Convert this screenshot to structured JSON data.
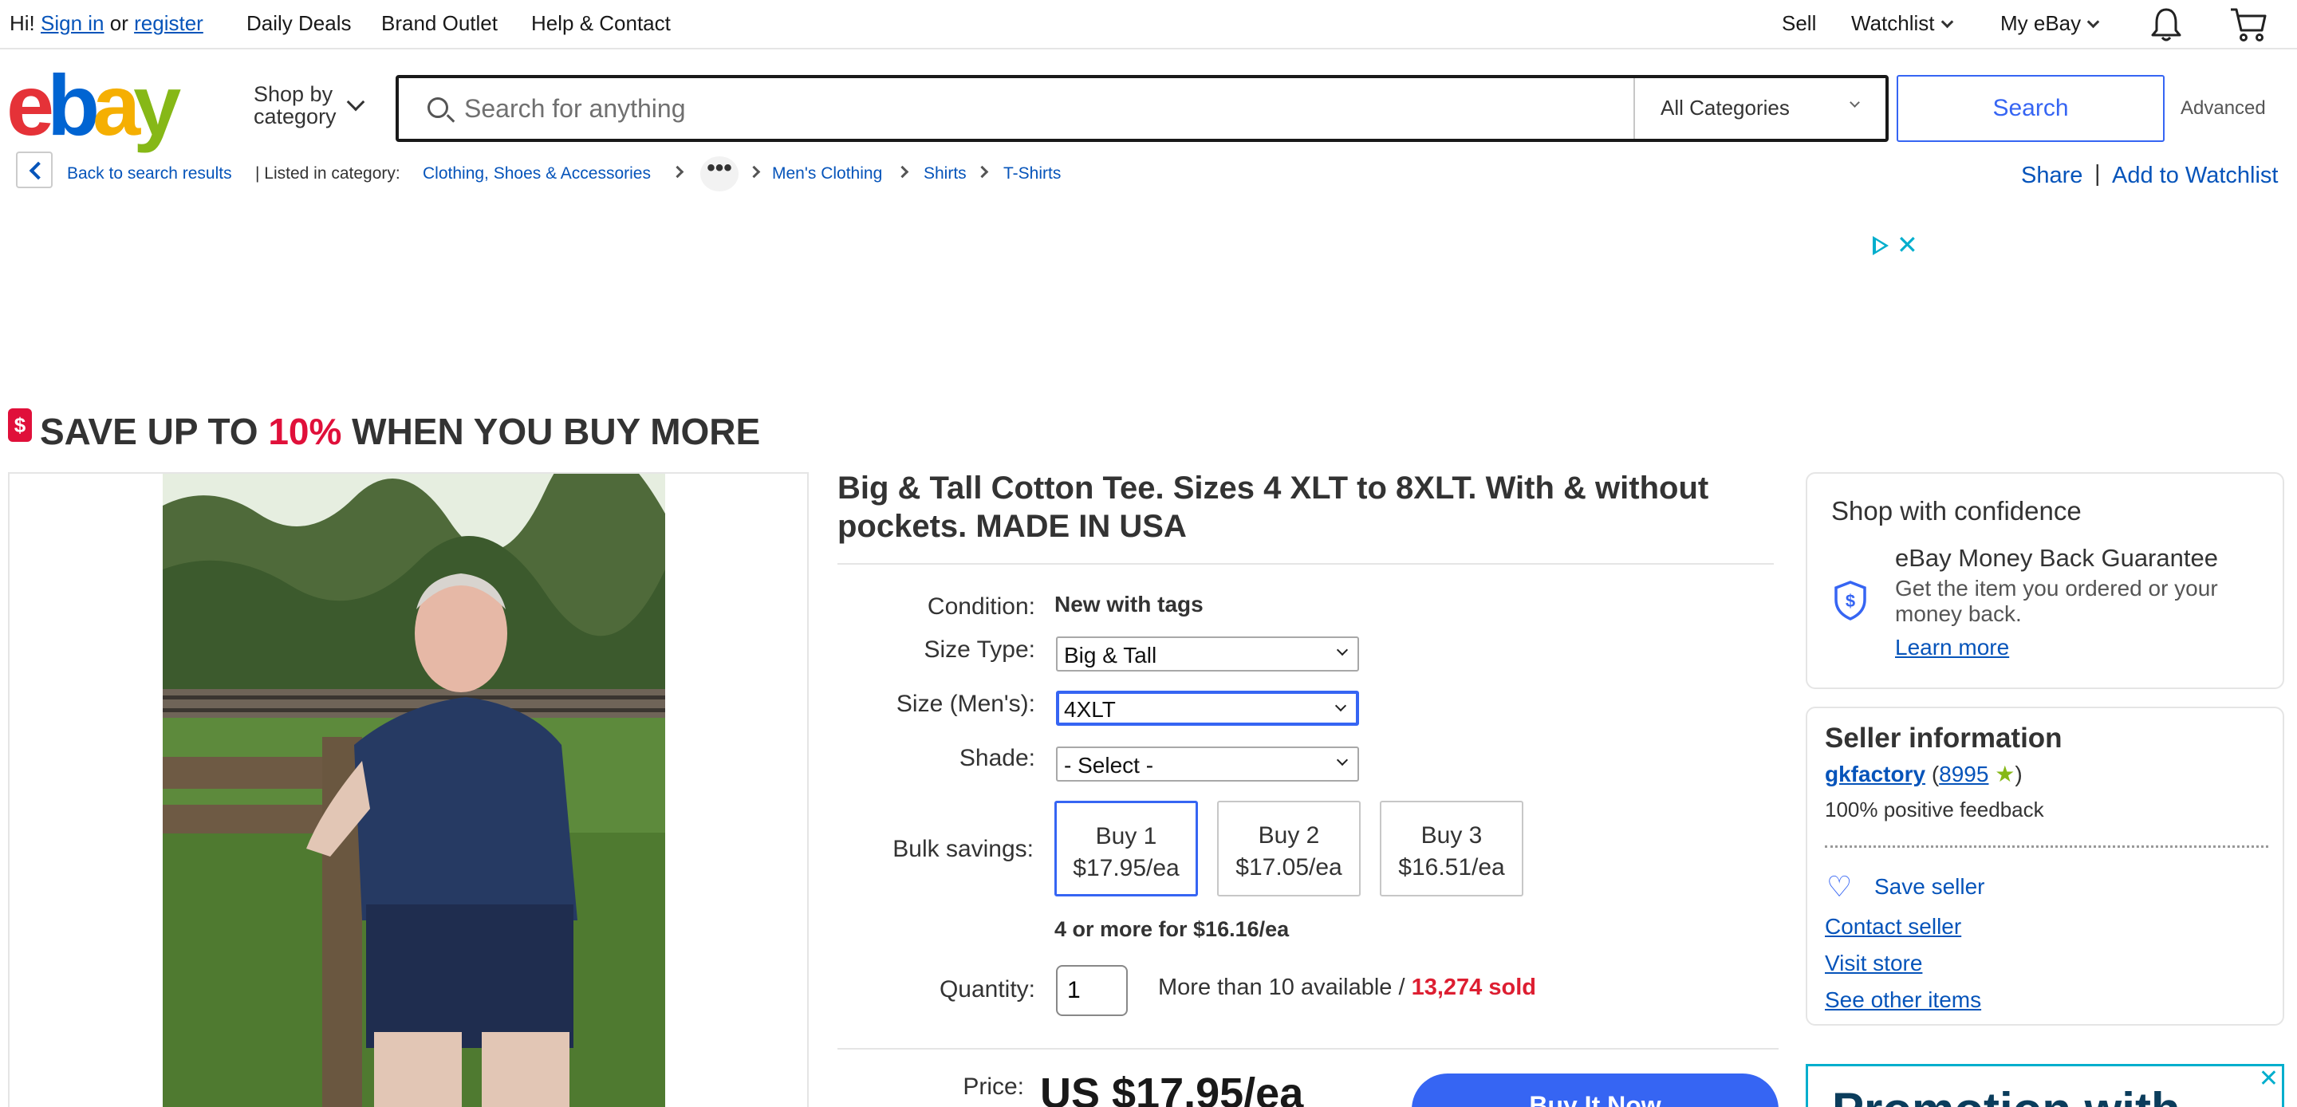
{
  "topbar": {
    "greeting": "Hi!",
    "sign_in": "Sign in",
    "or": "or",
    "register": "register",
    "daily_deals": "Daily Deals",
    "brand_outlet": "Brand Outlet",
    "help": "Help & Contact",
    "sell": "Sell",
    "watchlist": "Watchlist",
    "my_ebay": "My eBay",
    "icons": [
      "bell-icon",
      "cart-icon"
    ]
  },
  "header": {
    "logo": [
      "e",
      "b",
      "a",
      "y"
    ],
    "shop_by_1": "Shop by",
    "shop_by_2": "category",
    "search_placeholder": "Search for anything",
    "category": "All Categories",
    "search_button": "Search",
    "advanced": "Advanced"
  },
  "breadcrumb": {
    "back": "Back to search results",
    "listed_in": "| Listed in category:",
    "items": [
      "Clothing, Shoes & Accessories",
      "Men's Clothing",
      "Shirts",
      "T-Shirts"
    ],
    "more": "•••",
    "share": "Share",
    "pipe": "|",
    "add_watchlist": "Add to Watchlist"
  },
  "ad": {
    "close": "✕"
  },
  "promo": {
    "part1": "SAVE UP TO ",
    "percent": "10%",
    "part2": " WHEN YOU BUY MORE",
    "icon": "$"
  },
  "item": {
    "title": "Big & Tall Cotton Tee. Sizes 4 XLT to 8XLT. With & without pockets. MADE IN USA",
    "condition_label": "Condition:",
    "condition_value": "New with tags",
    "size_type_label": "Size Type:",
    "size_type_value": "Big & Tall",
    "size_label": "Size (Men's):",
    "size_value": "4XLT",
    "shade_label": "Shade:",
    "shade_value": "- Select -",
    "bulk_label": "Bulk savings:",
    "bulk": [
      {
        "line1": "Buy 1",
        "line2": "$17.95/ea"
      },
      {
        "line1": "Buy 2",
        "line2": "$17.05/ea"
      },
      {
        "line1": "Buy 3",
        "line2": "$16.51/ea"
      }
    ],
    "bulk_more": "4 or more for $16.16/ea",
    "quantity_label": "Quantity:",
    "quantity_value": "1",
    "available": "More than 10 available / ",
    "sold": "13,274 sold",
    "price_label": "Price:",
    "price": "US $17.95/ea",
    "buy_now": "Buy It Now"
  },
  "confidence": {
    "title": "Shop with confidence",
    "guarantee_title": "eBay Money Back Guarantee",
    "guarantee_desc": "Get the item you ordered or your money back.",
    "learn_more": "Learn more"
  },
  "seller": {
    "title": "Seller information",
    "name": "gkfactory",
    "score": "8995",
    "feedback": "100% positive feedback",
    "save": "Save seller",
    "contact": "Contact seller",
    "store": "Visit store",
    "other": "See other items"
  },
  "ad2": {
    "text": "Promotion with",
    "close": "✕"
  }
}
